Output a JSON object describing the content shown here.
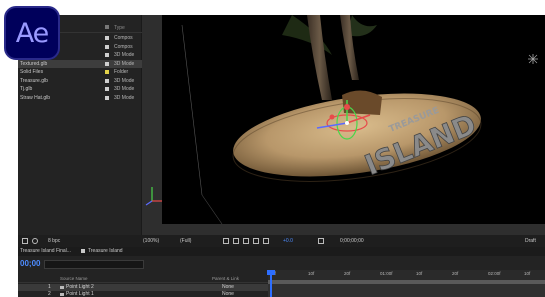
{
  "logo": {
    "text": "Ae"
  },
  "project": {
    "col_type": "Type",
    "items": [
      {
        "name": "",
        "type": "Compos",
        "swatch": "#cfcfcf"
      },
      {
        "name": "",
        "type": "Compos",
        "swatch": "#cfcfcf"
      },
      {
        "name": "",
        "type": "3D Mode",
        "swatch": "#cfcfcf"
      },
      {
        "name": "Textured.glb",
        "type": "3D Mode",
        "swatch": "#cfcfcf",
        "selected": true
      },
      {
        "name": "Solid Files",
        "type": "Folder",
        "swatch": "#e3d34a"
      },
      {
        "name": "Treasure.glb",
        "type": "3D Mode",
        "swatch": "#cfcfcf"
      },
      {
        "name": "Tj.glb",
        "type": "3D Mode",
        "swatch": "#cfcfcf"
      },
      {
        "name": "Straw Hat.glb",
        "type": "3D Mode",
        "swatch": "#cfcfcf"
      }
    ]
  },
  "viewer_toolbar": {
    "res": "8 bpc",
    "zoom": "(100%)",
    "quality": "(Full)",
    "exposure": "+0.0",
    "timecode": "0;00;00;00",
    "draft": "Draft"
  },
  "timeline": {
    "tab_comp": "Treasure Island Final...",
    "tab_island": "Treasure Island",
    "timecode": "00;00",
    "col_source": "Source Name",
    "col_parent": "Parent & Link",
    "rows": [
      {
        "num": "1",
        "name": "Point Light 2",
        "parent": "None",
        "selected": true
      },
      {
        "num": "2",
        "name": "Point Light 1",
        "parent": "None"
      }
    ],
    "ruler": [
      "0f",
      "10f",
      "20f",
      "01:00f",
      "10f",
      "20f",
      "02:00f",
      "10f"
    ]
  },
  "scene": {
    "text": "ISLAND",
    "subtitle": "TREASURE"
  }
}
